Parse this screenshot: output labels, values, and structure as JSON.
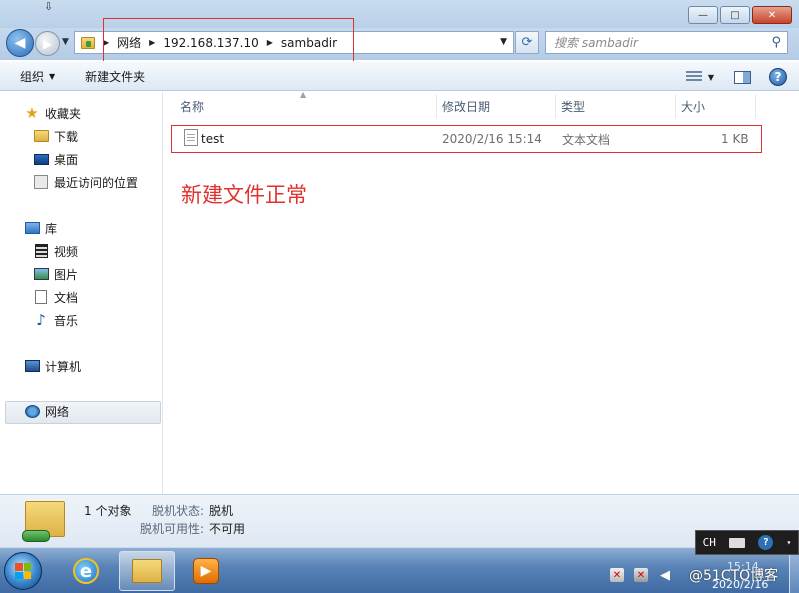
{
  "window": {
    "minimize": "—",
    "maximize": "□",
    "close": "✕"
  },
  "address": {
    "crumbs": [
      "网络",
      "192.168.137.10",
      "sambadir"
    ],
    "search_placeholder": "搜索 sambadir"
  },
  "toolbar": {
    "organize": "组织",
    "new_folder": "新建文件夹",
    "help": "?"
  },
  "nav": {
    "favorites": "收藏夹",
    "favorites_items": [
      "下载",
      "桌面",
      "最近访问的位置"
    ],
    "libraries": "库",
    "libraries_items": [
      "视频",
      "图片",
      "文档",
      "音乐"
    ],
    "computer": "计算机",
    "network": "网络"
  },
  "columns": {
    "name": "名称",
    "date": "修改日期",
    "type": "类型",
    "size": "大小"
  },
  "files": [
    {
      "name": "test",
      "date": "2020/2/16 15:14",
      "type": "文本文档",
      "size": "1 KB"
    }
  ],
  "annotation": "新建文件正常",
  "details": {
    "count": "1 个对象",
    "offline_status_label": "脱机状态:",
    "offline_status_value": "脱机",
    "offline_avail_label": "脱机可用性:",
    "offline_avail_value": "不可用"
  },
  "taskbar": {
    "lang": "CH",
    "clock_time": "15:14",
    "clock_date": "2020/2/16",
    "watermark": "@51CTO博客"
  },
  "colors": {
    "annotation": "#e0312e",
    "accent": "#2f6fb3"
  }
}
